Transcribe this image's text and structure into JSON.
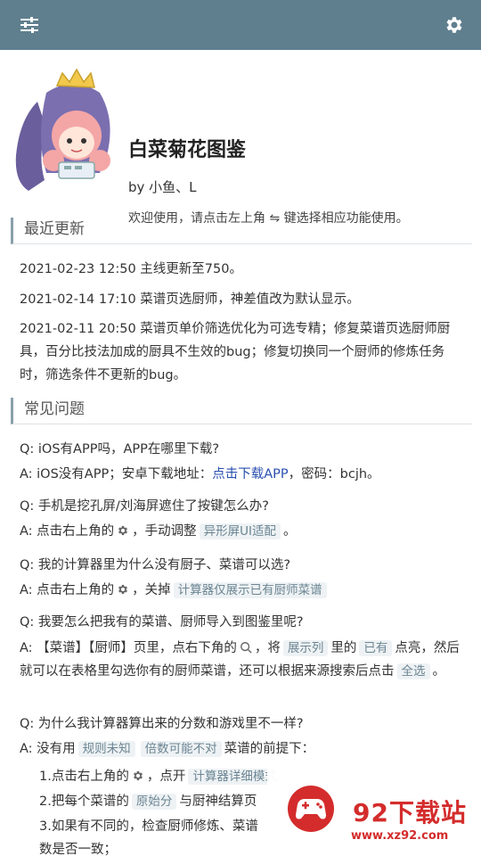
{
  "topbar": {
    "menu_icon": "sliders-icon",
    "settings_icon": "gear-icon"
  },
  "header": {
    "title": "白菜菊花图鉴",
    "author": "by 小鱼、L",
    "welcome": "欢迎使用，请点击左上角 ⇋ 键选择相应功能使用。"
  },
  "recent": {
    "heading": "最近更新",
    "items": [
      "2021-02-23 12:50 主线更新至750。",
      "2021-02-14 17:10 菜谱页选厨师，神差值改为默认显示。",
      "2021-02-11 20:50 菜谱页单价筛选优化为可选专精；修复菜谱页选厨师厨具，百分比技法加成的厨具不生效的bug；修复切换同一个厨师的修炼任务时，筛选条件不更新的bug。"
    ]
  },
  "faq": {
    "heading": "常见问题",
    "q1": {
      "q": "Q: iOS有APP吗，APP在哪里下载?",
      "a_prefix": "A: iOS没有APP；安卓下载地址：",
      "a_link": "点击下载APP",
      "a_suffix": "，密码：bcjh。"
    },
    "q2": {
      "q": "Q: 手机是挖孔屏/刘海屏遮住了按键怎么办?",
      "a_prefix": "A: 点击右上角的",
      "a_mid": "，手动调整",
      "a_code": "异形屏UI适配",
      "a_suffix": "。"
    },
    "q3": {
      "q": "Q: 我的计算器里为什么没有厨子、菜谱可以选?",
      "a_prefix": "A: 点击右上角的",
      "a_mid": "，关掉",
      "a_code": "计算器仅展示已有厨师菜谱"
    },
    "q4": {
      "q": "Q: 我要怎么把我有的菜谱、厨师导入到图鉴里呢?",
      "a_prefix": "A: 【菜谱】【厨师】页里，点右下角的",
      "a_mid1": "，将",
      "a_code1": "展示列",
      "a_mid2": "里的",
      "a_code2": "已有",
      "a_mid3": "点亮，然后就可以在表格里勾选你有的厨师菜谱，还可以根据来源搜索后点击",
      "a_code3": "全选",
      "a_suffix": "。"
    },
    "q5": {
      "q": "Q: 为什么我计算器算出来的分数和游戏里不一样?",
      "a_prefix": "A: 没有用",
      "a_code1": "规则未知",
      "a_code2": "倍数可能不对",
      "a_suffix": "菜谱的前提下：",
      "s1_prefix": "1.点击右上角的",
      "s1_mid": "，点开",
      "s1_code": "计算器详细模式",
      "s2_prefix": "2.把每个菜谱的",
      "s2_code": "原始分",
      "s2_suffix": "与厨神结算页",
      "s3": "3.如果有不同的，检查厨师修炼、菜谱",
      "s3b": "数是否一致；"
    }
  },
  "watermark": {
    "title": "92下载站",
    "url": "www.xz92.com"
  }
}
